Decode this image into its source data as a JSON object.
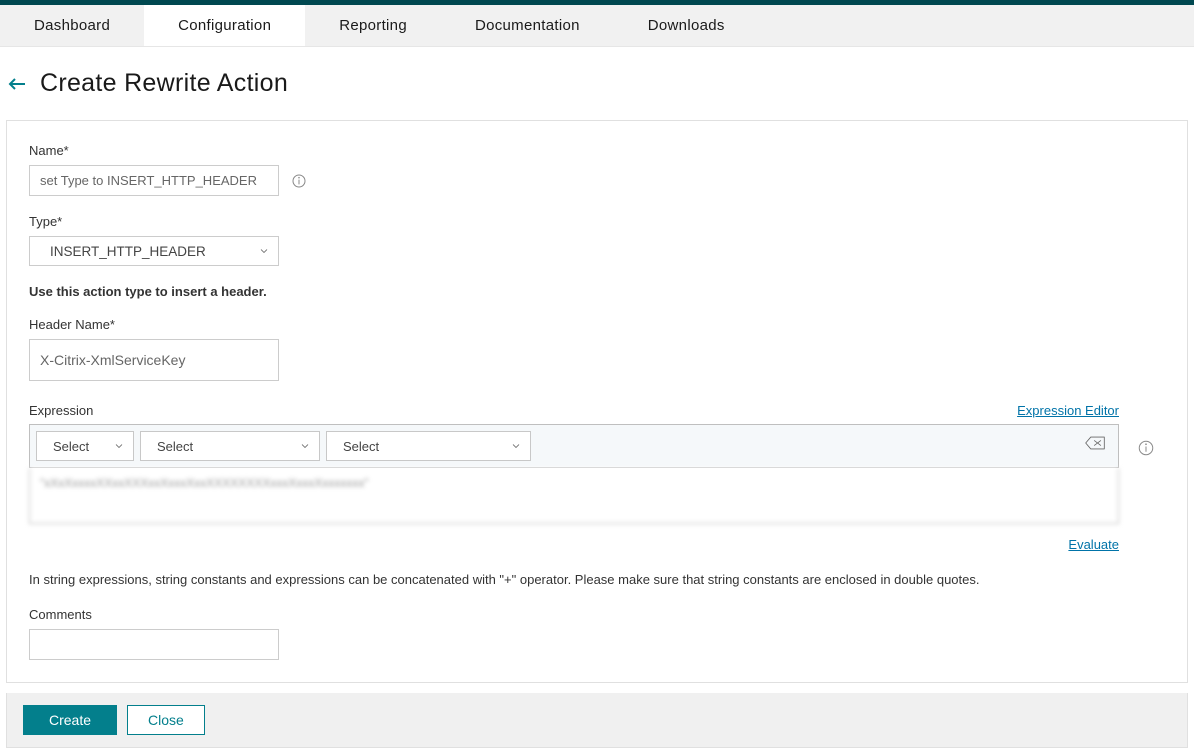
{
  "tabs": [
    "Dashboard",
    "Configuration",
    "Reporting",
    "Documentation",
    "Downloads"
  ],
  "page_title": "Create Rewrite Action",
  "form": {
    "name_label": "Name*",
    "name_value": "set Type to INSERT_HTTP_HEADER",
    "type_label": "Type*",
    "type_value": "INSERT_HTTP_HEADER",
    "type_help": "Use this action type to insert a header.",
    "header_name_label": "Header Name*",
    "header_name_value": "X-Citrix-XmlServiceKey",
    "expression_label": "Expression",
    "expression_editor_link": "Expression Editor",
    "expr_select1": "Select",
    "expr_select2": "Select",
    "expr_select3": "Select",
    "expr_text": "\"xXxXxxxxXXxxXXXxxXxxxXxxXXXXXXXXxxxXxxxXxxxxxxx\"",
    "evaluate_link": "Evaluate",
    "concat_hint": "In string expressions, string constants and expressions can be concatenated with \"+\" operator. Please make sure that string constants are enclosed in double quotes.",
    "comments_label": "Comments",
    "comments_value": ""
  },
  "buttons": {
    "create": "Create",
    "close": "Close"
  }
}
